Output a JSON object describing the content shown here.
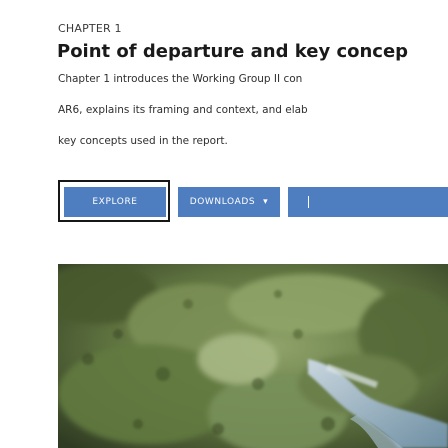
{
  "chapter": {
    "eyebrow": "CHAPTER 1",
    "title": "Point of departure and key concep",
    "body_lines": [
      "Chapter 1 introduces the Working Group II con",
      "AR6, explains its framing and context, and elab",
      "key concepts used in the report."
    ]
  },
  "actions": {
    "explore_label": "EXPLORE",
    "downloads_label": "DOWNLOADS",
    "downloads_caret": "▾"
  },
  "hero": {
    "image_name": "aerial-landscape-photo"
  },
  "colors": {
    "button_bg": "#4f7ec0",
    "focus_ring": "#161616",
    "title_text": "#1a1a1a"
  }
}
